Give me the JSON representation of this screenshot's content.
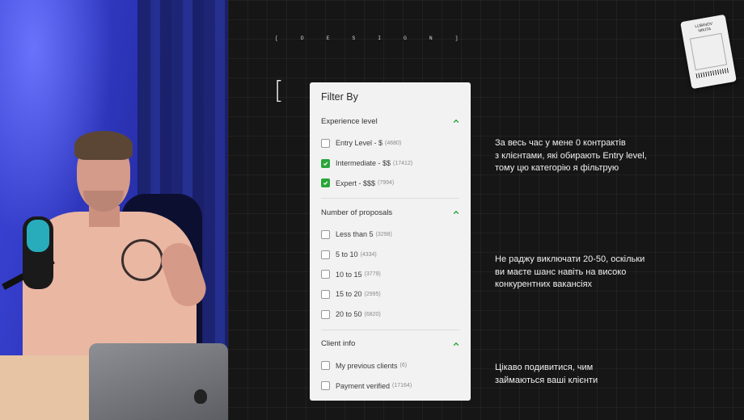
{
  "header": {
    "tag": "[ D E S I G N ]",
    "bracket": "["
  },
  "filter": {
    "title": "Filter By",
    "accent": "#2aa63a",
    "sections": [
      {
        "title": "Experience level",
        "options": [
          {
            "label": "Entry Level - $",
            "count": "(4680)",
            "checked": false
          },
          {
            "label": "Intermediate - $$",
            "count": "(17412)",
            "checked": true
          },
          {
            "label": "Expert - $$$",
            "count": "(7994)",
            "checked": true
          }
        ]
      },
      {
        "title": "Number of proposals",
        "options": [
          {
            "label": "Less than 5",
            "count": "(3298)",
            "checked": false
          },
          {
            "label": "5 to 10",
            "count": "(4334)",
            "checked": false
          },
          {
            "label": "10 to 15",
            "count": "(3779)",
            "checked": false
          },
          {
            "label": "15 to 20",
            "count": "(2995)",
            "checked": false
          },
          {
            "label": "20 to 50",
            "count": "(6820)",
            "checked": false
          }
        ]
      },
      {
        "title": "Client info",
        "options": [
          {
            "label": "My previous clients",
            "count": "(6)",
            "checked": false
          },
          {
            "label": "Payment verified",
            "count": "(17164)",
            "checked": false
          }
        ]
      }
    ]
  },
  "notes": {
    "note1": [
      "За весь час у мене 0 контрактів",
      "з клієнтами, які обирають Entry level,",
      "тому цю категорію я фільтрую"
    ],
    "note2": [
      "Не раджу виключати 20-50, оскільки",
      "ви маєте шанс навіть на високо",
      "конкурентних вакансіях"
    ],
    "note3": [
      "Цікаво подивитися, чим",
      "займаються ваші клієнти"
    ]
  },
  "sticker": {
    "line1": "LUBINOV",
    "line2": "NIKITA"
  }
}
